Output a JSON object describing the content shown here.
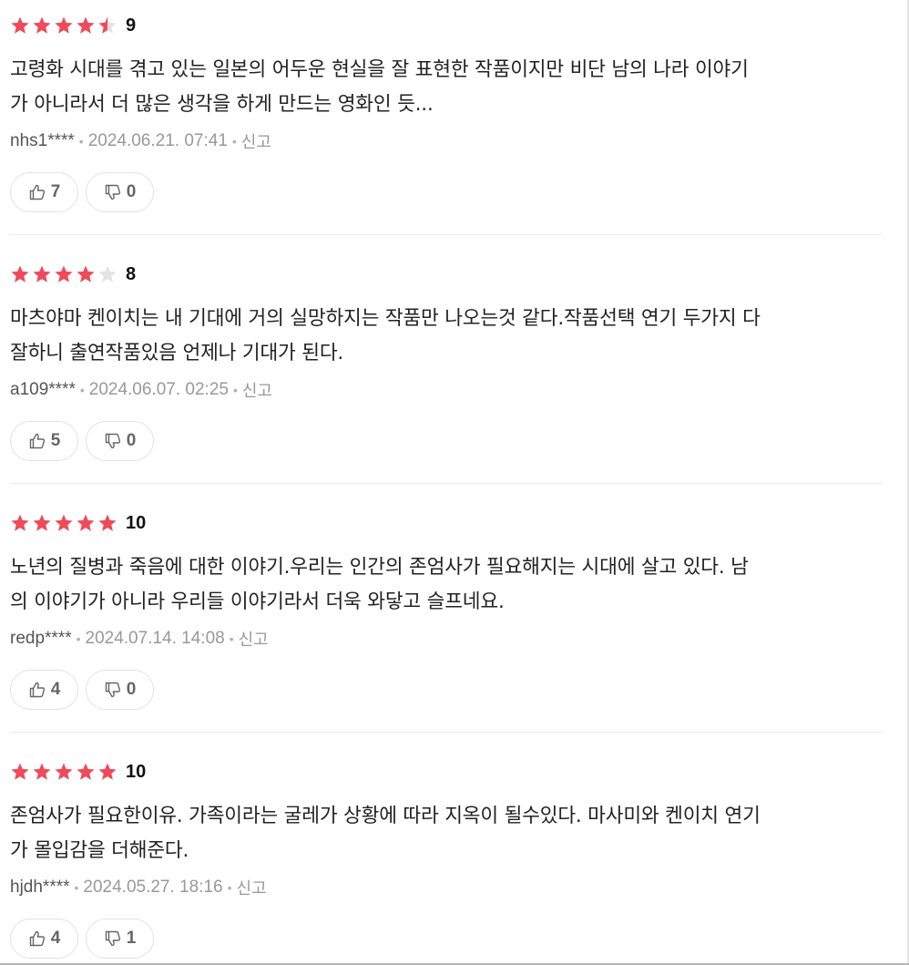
{
  "colors": {
    "star_filled": "#ef4a5a",
    "star_empty": "#e3e3e3",
    "text": "#222222",
    "meta": "#999999"
  },
  "meta_separator": "•",
  "reviews": [
    {
      "rating": 4.5,
      "score": "9",
      "content": "고령화 시대를 겪고 있는 일본의 어두운 현실을 잘 표현한 작품이지만 비단 남의 나라 이야기\n가 아니라서 더 많은 생각을 하게 만드는 영화인 듯...",
      "user": "nhs1****",
      "date": "2024.06.21. 07:41",
      "report": "신고",
      "likes": "7",
      "dislikes": "0"
    },
    {
      "rating": 4,
      "score": "8",
      "content": "마츠야마 켄이치는 내 기대에 거의 실망하지는 작품만 나오는것 같다.작품선택 연기 두가지 다\n잘하니 출연작품있음 언제나 기대가 된다.",
      "user": "a109****",
      "date": "2024.06.07. 02:25",
      "report": "신고",
      "likes": "5",
      "dislikes": "0"
    },
    {
      "rating": 5,
      "score": "10",
      "content": "노년의 질병과 죽음에 대한 이야기.우리는 인간의 존엄사가 필요해지는 시대에 살고 있다. 남\n의 이야기가 아니라 우리들 이야기라서 더욱 와닿고 슬프네요.",
      "user": "redp****",
      "date": "2024.07.14. 14:08",
      "report": "신고",
      "likes": "4",
      "dislikes": "0"
    },
    {
      "rating": 5,
      "score": "10",
      "content": "존엄사가 필요한이유. 가족이라는 굴레가 상황에 따라 지옥이 될수있다. 마사미와 켄이치 연기\n가 몰입감을 더해준다.",
      "user": "hjdh****",
      "date": "2024.05.27. 18:16",
      "report": "신고",
      "likes": "4",
      "dislikes": "1"
    }
  ]
}
